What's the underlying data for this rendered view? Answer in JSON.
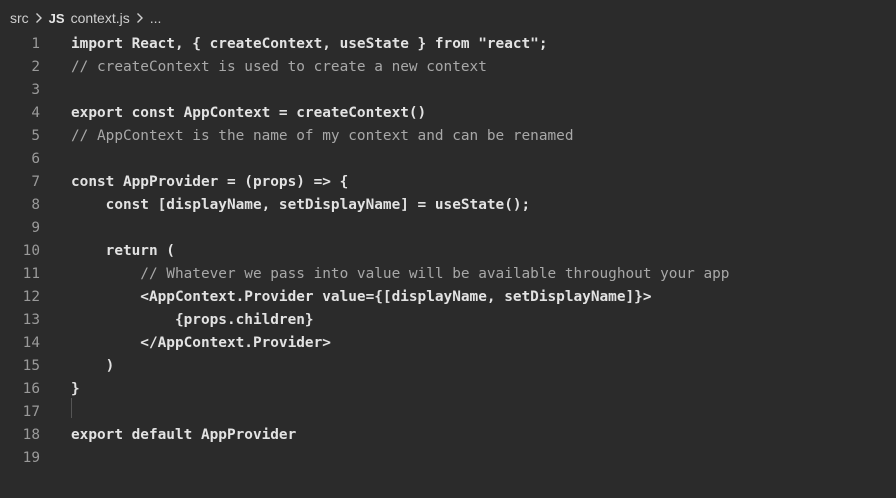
{
  "breadcrumb": {
    "folder": "src",
    "file_type_icon": "JS",
    "file": "context.js",
    "more": "..."
  },
  "editor": {
    "lines": [
      {
        "number": "1",
        "text": "import React, { createContext, useState } from \"react\";"
      },
      {
        "number": "2",
        "text": "// createContext is used to create a new context"
      },
      {
        "number": "3",
        "text": ""
      },
      {
        "number": "4",
        "text": "export const AppContext = createContext()"
      },
      {
        "number": "5",
        "text": "// AppContext is the name of my context and can be renamed"
      },
      {
        "number": "6",
        "text": ""
      },
      {
        "number": "7",
        "text": "const AppProvider = (props) => {"
      },
      {
        "number": "8",
        "text": "    const [displayName, setDisplayName] = useState();"
      },
      {
        "number": "9",
        "text": ""
      },
      {
        "number": "10",
        "text": "    return ("
      },
      {
        "number": "11",
        "text": "        // Whatever we pass into value will be available throughout your app"
      },
      {
        "number": "12",
        "text": "        <AppContext.Provider value={[displayName, setDisplayName]}>"
      },
      {
        "number": "13",
        "text": "            {props.children}"
      },
      {
        "number": "14",
        "text": "        </AppContext.Provider>"
      },
      {
        "number": "15",
        "text": "    )"
      },
      {
        "number": "16",
        "text": "}"
      },
      {
        "number": "17",
        "text": ""
      },
      {
        "number": "18",
        "text": "export default AppProvider"
      },
      {
        "number": "19",
        "text": ""
      }
    ]
  },
  "colors": {
    "background": "#2b2b2b",
    "line_number": "#9a9a9a",
    "code_text": "#e2e2e2",
    "comment": "#a8a8a8"
  },
  "icons": {
    "breadcrumb_separator": "chevron-right-icon",
    "file_type": "javascript-file-icon"
  }
}
